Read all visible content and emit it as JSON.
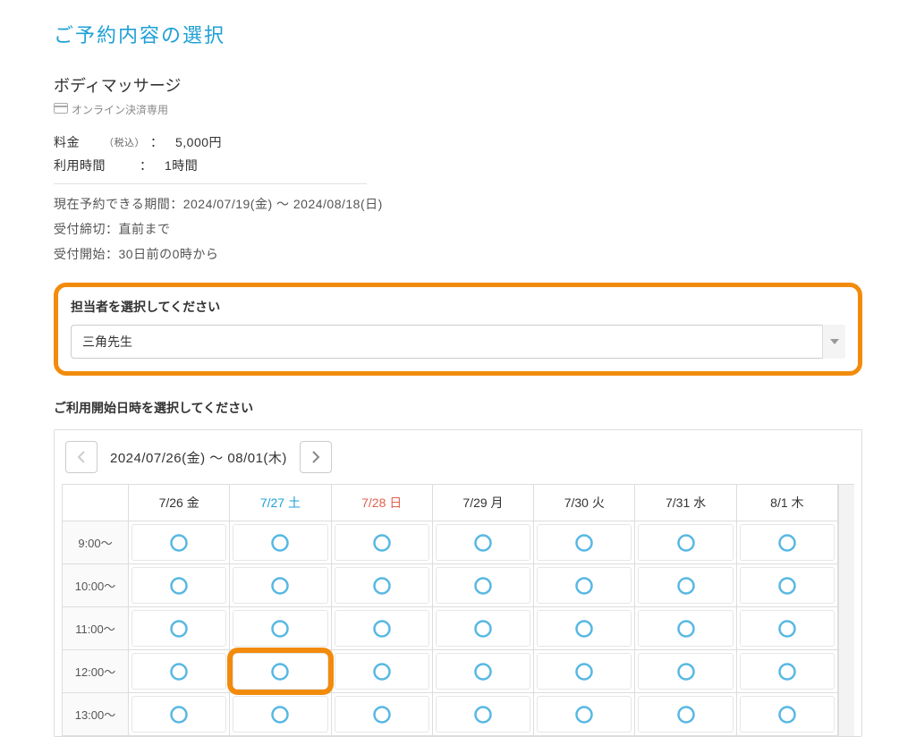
{
  "page_title": "ご予約内容の選択",
  "service_name": "ボディマッサージ",
  "online_badge": "オンライン決済専用",
  "fee": {
    "label": "料金",
    "tax_hint": "（税込）",
    "colon": "：",
    "value": "5,000円"
  },
  "duration": {
    "label": "利用時間",
    "colon": "：",
    "value": "1時間"
  },
  "meta_period": "現在予約できる期間：2024/07/19(金) 〜 2024/08/18(日)",
  "meta_deadline": "受付締切：直前まで",
  "meta_start": "受付開始：30日前の0時から",
  "staff_section_label": "担当者を選択してください",
  "staff_selected": "三角先生",
  "time_section_label": "ご利用開始日時を選択してください",
  "cal_range": "2024/07/26(金) 〜 08/01(木)",
  "days": [
    {
      "label": "7/26 金",
      "cls": ""
    },
    {
      "label": "7/27 土",
      "cls": "sat"
    },
    {
      "label": "7/28 日",
      "cls": "sun"
    },
    {
      "label": "7/29 月",
      "cls": ""
    },
    {
      "label": "7/30 火",
      "cls": ""
    },
    {
      "label": "7/31 水",
      "cls": ""
    },
    {
      "label": "8/1 木",
      "cls": ""
    }
  ],
  "times": [
    "9:00〜",
    "10:00〜",
    "11:00〜",
    "12:00〜",
    "13:00〜"
  ]
}
